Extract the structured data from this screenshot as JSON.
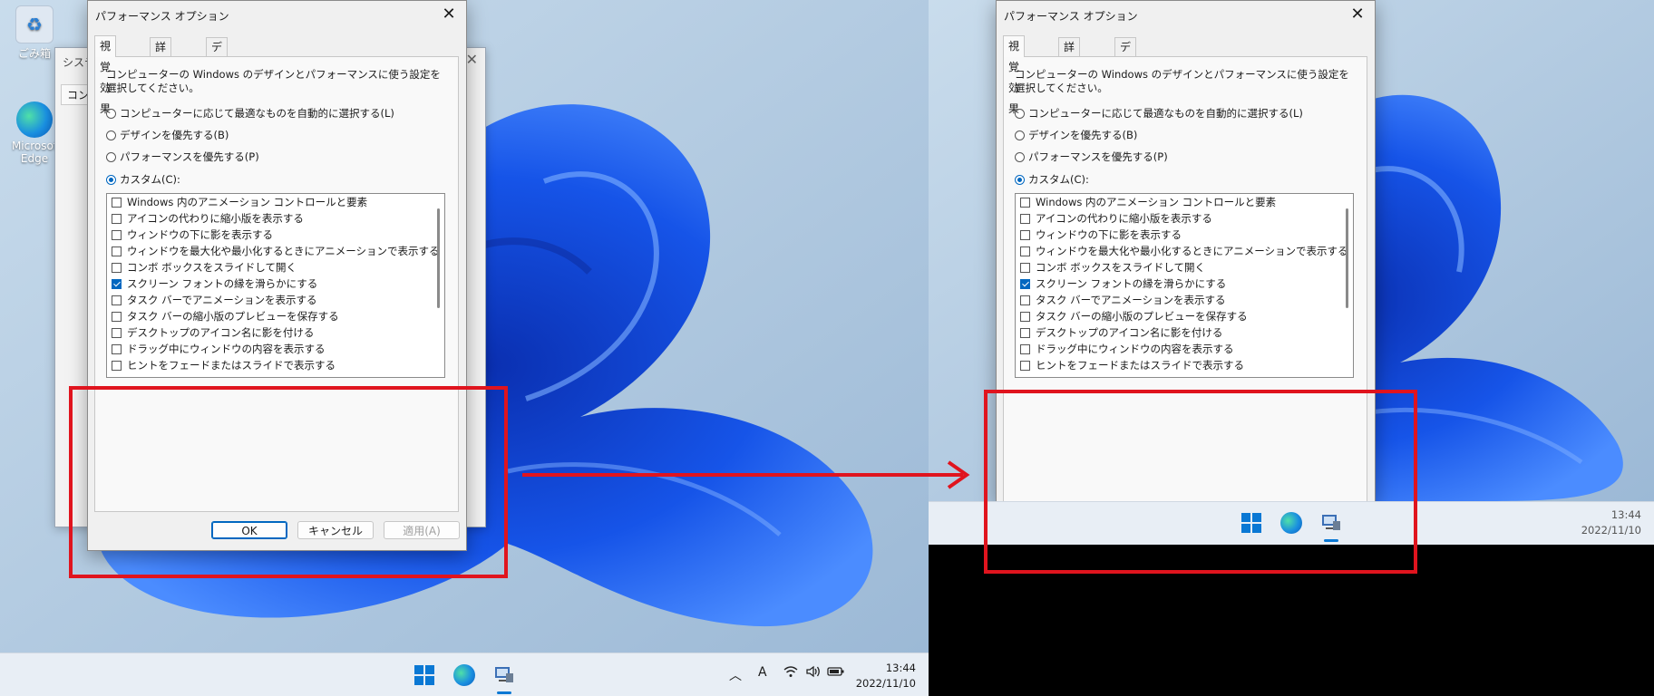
{
  "dialog": {
    "title": "パフォーマンス オプション",
    "close_glyph": "✕",
    "tabs": [
      "視覚効果",
      "詳細設定",
      "データ実行防止"
    ],
    "description": "コンピューターの Windows のデザインとパフォーマンスに使う設定を選択してください。",
    "radios": [
      {
        "label": "コンピューターに応じて最適なものを自動的に選択する(L)",
        "selected": false
      },
      {
        "label": "デザインを優先する(B)",
        "selected": false
      },
      {
        "label": "パフォーマンスを優先する(P)",
        "selected": false
      },
      {
        "label": "カスタム(C):",
        "selected": true
      }
    ],
    "options": [
      {
        "label": "Windows 内のアニメーション コントロールと要素",
        "checked": false
      },
      {
        "label": "アイコンの代わりに縮小版を表示する",
        "checked": false
      },
      {
        "label": "ウィンドウの下に影を表示する",
        "checked": false
      },
      {
        "label": "ウィンドウを最大化や最小化するときにアニメーションで表示する",
        "checked": false
      },
      {
        "label": "コンボ ボックスをスライドして開く",
        "checked": false
      },
      {
        "label": "スクリーン フォントの縁を滑らかにする",
        "checked": true
      },
      {
        "label": "タスク バーでアニメーションを表示する",
        "checked": false
      },
      {
        "label": "タスク バーの縮小版のプレビューを保存する",
        "checked": false
      },
      {
        "label": "デスクトップのアイコン名に影を付ける",
        "checked": false
      },
      {
        "label": "ドラッグ中にウィンドウの内容を表示する",
        "checked": false
      },
      {
        "label": "ヒントをフェードまたはスライドで表示する",
        "checked": false
      }
    ],
    "buttons": {
      "ok": "OK",
      "cancel": "キャンセル",
      "apply": "適用(A)"
    }
  },
  "background_window": {
    "title": "システ",
    "tab": "コンピ"
  },
  "desktop": {
    "recycle_bin_label": "ごみ箱",
    "edge_label_line1": "Microsof",
    "edge_label_line2": "Edge"
  },
  "taskbar": {
    "time": "13:44",
    "date": "2022/11/10",
    "ime_indicator": "A",
    "tray_icons": [
      "chevron-up-icon",
      "wifi-icon",
      "volume-icon",
      "battery-icon"
    ],
    "pinned_icons": [
      "windows-start-icon",
      "edge-icon",
      "performance-options-app-icon"
    ]
  },
  "colors": {
    "accent": "#0067c0",
    "annotation_red": "#e0141e",
    "wallpaper_blue": "#1a4fd8"
  }
}
